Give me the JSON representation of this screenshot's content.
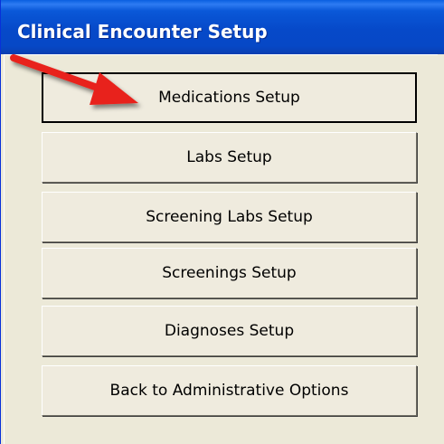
{
  "window": {
    "title": "Clinical Encounter Setup"
  },
  "menu": {
    "buttons": [
      {
        "label": "Medications Setup"
      },
      {
        "label": "Labs Setup"
      },
      {
        "label": "Screening Labs Setup"
      },
      {
        "label": "Screenings Setup"
      },
      {
        "label": "Diagnoses Setup"
      },
      {
        "label": "Back to Administrative Options"
      }
    ]
  },
  "annotation": {
    "arrow_color": "#E8211B",
    "points_to": "Medications Setup"
  }
}
